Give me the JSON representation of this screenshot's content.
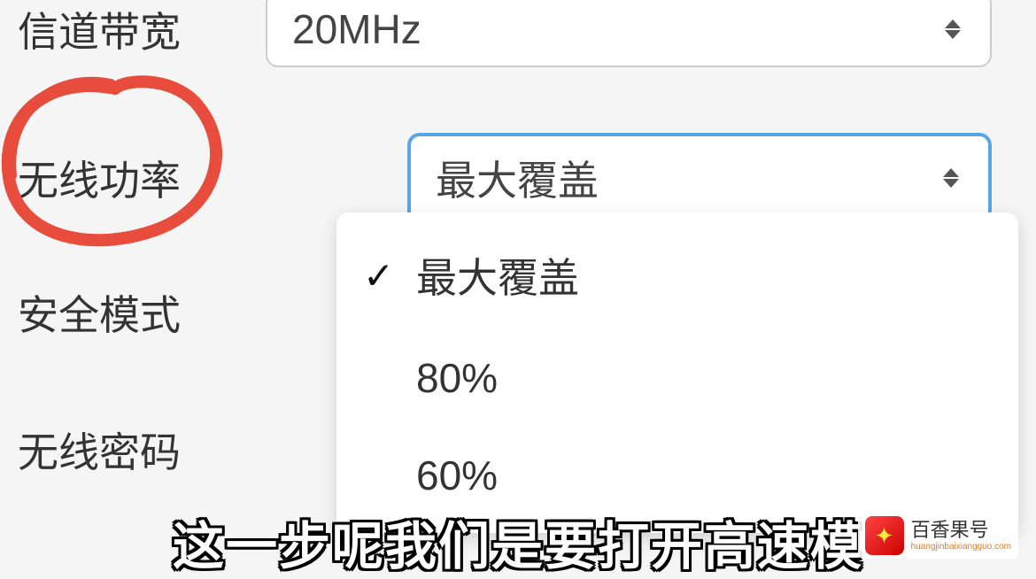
{
  "fields": {
    "channel_bandwidth": {
      "label": "信道带宽",
      "value": "20MHz"
    },
    "wireless_power": {
      "label": "无线功率",
      "value": "最大覆盖"
    },
    "security_mode": {
      "label": "安全模式"
    },
    "wireless_password": {
      "label": "无线密码"
    }
  },
  "dropdown": {
    "options": [
      {
        "label": "最大覆盖",
        "selected": true
      },
      {
        "label": "80%",
        "selected": false
      },
      {
        "label": "60%",
        "selected": false
      }
    ]
  },
  "subtitle": "这一步呢我们是要打开高速模",
  "watermark": {
    "title": "百香果号",
    "url": "huangjinbaixiangguo.com"
  }
}
